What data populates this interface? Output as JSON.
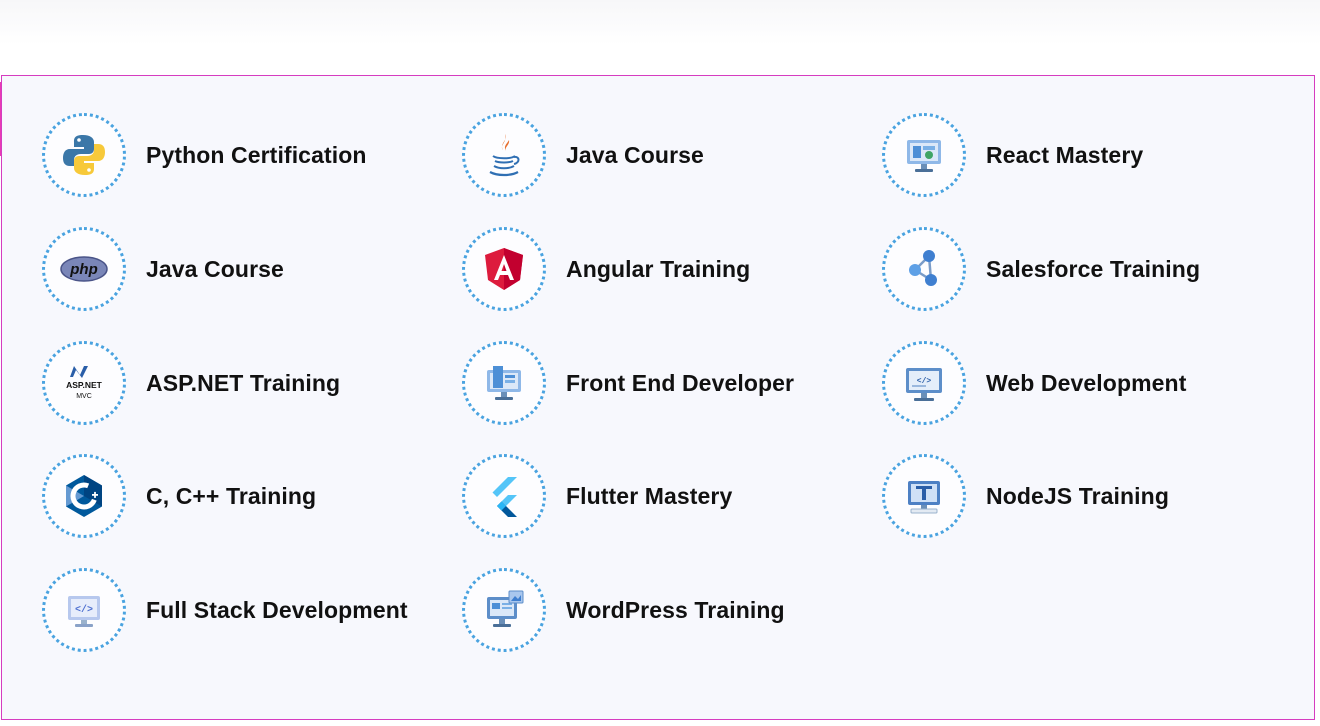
{
  "courses": [
    {
      "label": "Python Certification",
      "icon": "python-icon"
    },
    {
      "label": "Java Course",
      "icon": "java-icon"
    },
    {
      "label": "React Mastery",
      "icon": "react-monitor-icon"
    },
    {
      "label": "Java Course",
      "icon": "php-icon"
    },
    {
      "label": "Angular Training",
      "icon": "angular-icon"
    },
    {
      "label": "Salesforce Training",
      "icon": "network-nodes-icon"
    },
    {
      "label": "ASP.NET Training",
      "icon": "aspnet-mvc-icon"
    },
    {
      "label": "Front End Developer",
      "icon": "frontend-monitor-icon"
    },
    {
      "label": "Web Development",
      "icon": "code-monitor-icon"
    },
    {
      "label": "C, C++ Training",
      "icon": "cpp-icon"
    },
    {
      "label": "Flutter Mastery",
      "icon": "flutter-icon"
    },
    {
      "label": "NodeJS Training",
      "icon": "nodejs-monitor-icon"
    },
    {
      "label": "Full Stack Development",
      "icon": "code-window-icon"
    },
    {
      "label": "WordPress Training",
      "icon": "wordpress-monitor-icon"
    }
  ],
  "icon_text": {
    "php": "php",
    "aspnet": "ASP.NET",
    "mvc": "MVC",
    "code": "</>"
  },
  "colors": {
    "panel_border": "#d63cc0",
    "accent": "#e83bb4",
    "ring": "#4aa3e0"
  }
}
